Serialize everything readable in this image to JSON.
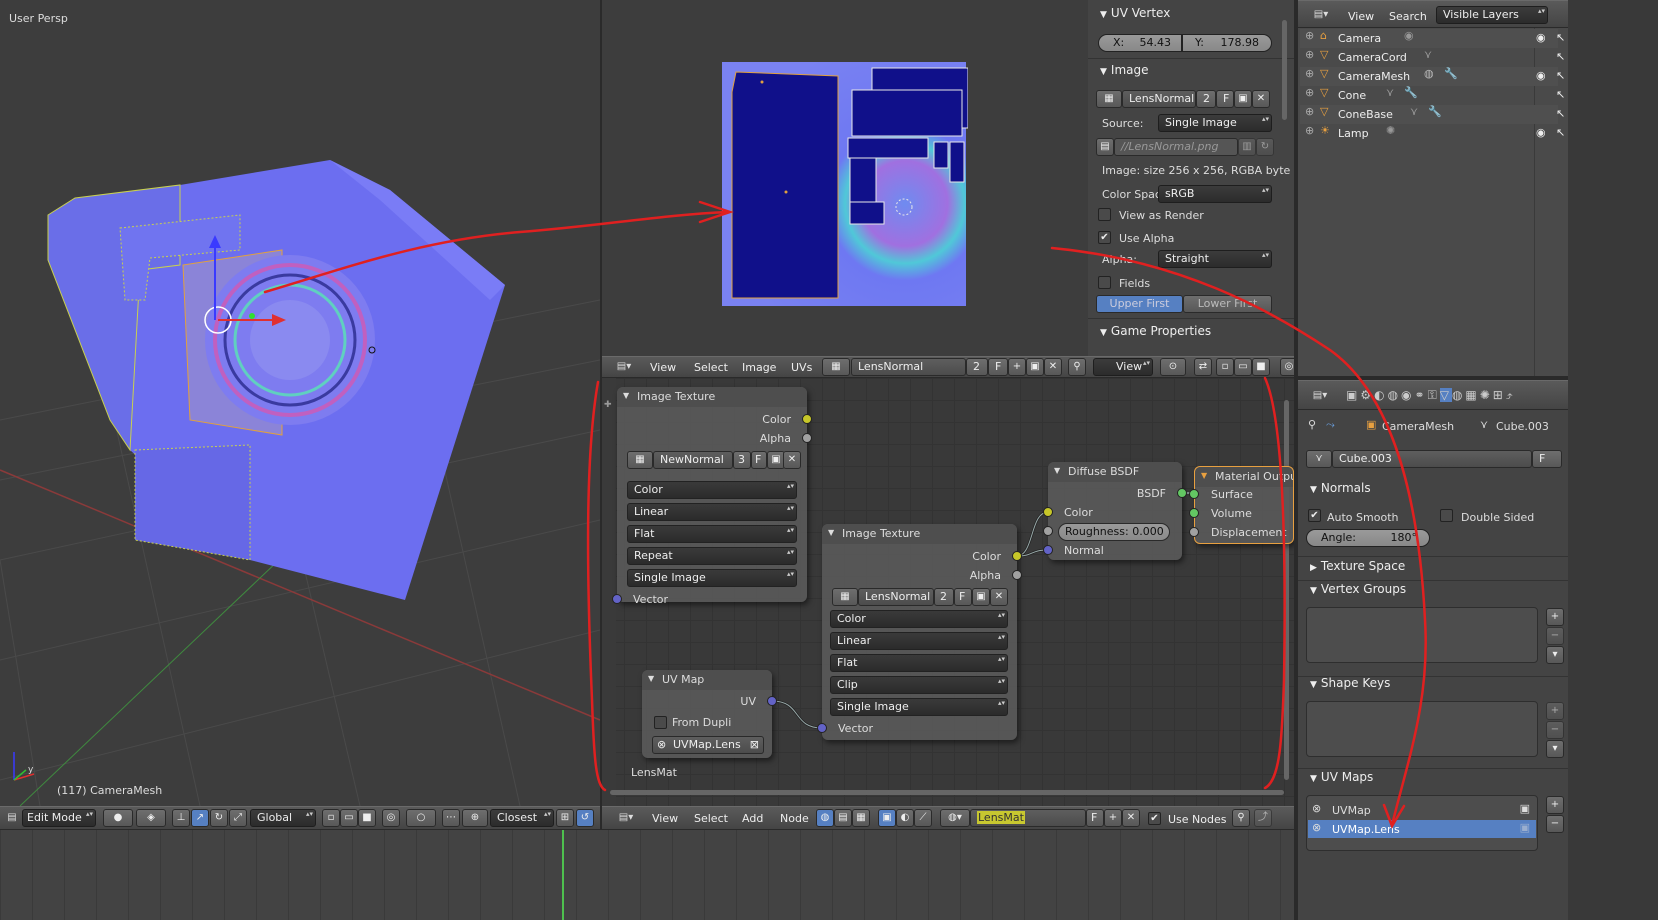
{
  "viewport3d": {
    "title": "User Persp",
    "object_info": "(117) CameraMesh",
    "axis_y": "y"
  },
  "header3d": {
    "mode": "Edit Mode",
    "orientation": "Global",
    "snap": "Closest"
  },
  "uv_header": {
    "menus": [
      "View",
      "Select",
      "Image",
      "UVs"
    ],
    "image_name": "LensNormal",
    "image_users": "2",
    "fake_user": "F",
    "view_label": "View"
  },
  "uv_vertex": {
    "title": "UV Vertex",
    "x_label": "X:",
    "x_value": "54.43",
    "y_label": "Y:",
    "y_value": "178.98"
  },
  "image_panel": {
    "title": "Image",
    "image_name": "LensNormal",
    "users": "2",
    "fake": "F",
    "source_label": "Source:",
    "source_value": "Single Image",
    "filepath": "//LensNormal.png",
    "info": "Image: size 256 x 256, RGBA byte",
    "colorspace_label": "Color Spac",
    "colorspace_value": "sRGB",
    "view_as_render": "View as Render",
    "use_alpha": "Use Alpha",
    "alpha_label": "Alpha:",
    "alpha_value": "Straight",
    "fields": "Fields",
    "upper_first": "Upper First",
    "lower_first": "Lower First",
    "game_properties": "Game Properties"
  },
  "outliner": {
    "menus": [
      "View",
      "Search"
    ],
    "filter": "Visible Layers",
    "items": [
      "Camera",
      "CameraCord",
      "CameraMesh",
      "Cone",
      "ConeBase",
      "Lamp"
    ]
  },
  "properties": {
    "breadcrumb_object": "CameraMesh",
    "breadcrumb_mesh": "Cube.003",
    "mesh_name": "Cube.003",
    "fake": "F",
    "normals_title": "Normals",
    "auto_smooth": "Auto Smooth",
    "double_sided": "Double Sided",
    "angle_label": "Angle:",
    "angle_value": "180°",
    "texture_space": "Texture Space",
    "vertex_groups": "Vertex Groups",
    "shape_keys": "Shape Keys",
    "uv_maps_title": "UV Maps",
    "uv_maps": [
      "UVMap",
      "UVMap.Lens"
    ]
  },
  "node_header": {
    "menus": [
      "View",
      "Select",
      "Add",
      "Node"
    ],
    "material": "LensMat",
    "fake": "F",
    "use_nodes": "Use Nodes"
  },
  "nodes": {
    "tex1": {
      "title": "Image Texture",
      "out_color": "Color",
      "out_alpha": "Alpha",
      "image": "NewNormal",
      "users": "3",
      "fake": "F",
      "color": "Color",
      "interp": "Linear",
      "proj": "Flat",
      "ext": "Repeat",
      "source": "Single Image",
      "vector": "Vector"
    },
    "tex2": {
      "title": "Image Texture",
      "out_color": "Color",
      "out_alpha": "Alpha",
      "image": "LensNormal",
      "users": "2",
      "fake": "F",
      "color": "Color",
      "interp": "Linear",
      "proj": "Flat",
      "ext": "Clip",
      "source": "Single Image",
      "vector": "Vector"
    },
    "uvmap": {
      "title": "UV Map",
      "out_uv": "UV",
      "from_dupli": "From Dupli",
      "map": "UVMap.Lens"
    },
    "diffuse": {
      "title": "Diffuse BSDF",
      "out_bsdf": "BSDF",
      "color": "Color",
      "roughness": "Roughness: 0.000",
      "normal": "Normal"
    },
    "output": {
      "title": "Material Outpu",
      "surface": "Surface",
      "volume": "Volume",
      "displacement": "Displacement"
    },
    "frame_label": "LensMat"
  }
}
